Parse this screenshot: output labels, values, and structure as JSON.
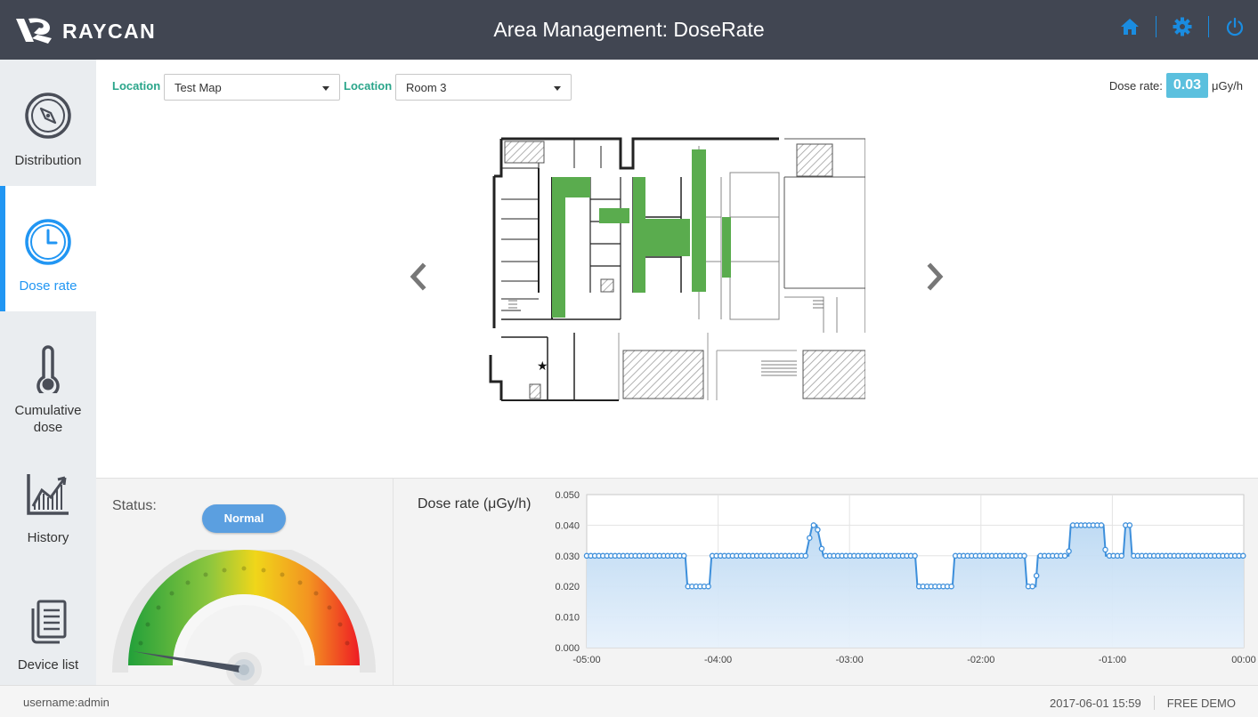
{
  "header": {
    "brand": "RAYCAN",
    "title": "Area Management: DoseRate",
    "icons": [
      "home-icon",
      "gear-icon",
      "power-icon"
    ],
    "icon_color": "#1a8ce0"
  },
  "sidebar": {
    "items": [
      {
        "label": "Distribution",
        "icon": "compass-icon"
      },
      {
        "label": "Dose rate",
        "icon": "clock-icon",
        "active": true
      },
      {
        "label": "Cumulative dose",
        "icon": "thermometer-icon"
      },
      {
        "label": "History",
        "icon": "chart-history-icon"
      },
      {
        "label": "Device list",
        "icon": "document-list-icon"
      }
    ],
    "active_color": "#2196f3"
  },
  "filters": {
    "location1_label": "Location",
    "location1_value": "Test Map",
    "location2_label": "Location",
    "location2_value": "Room 3"
  },
  "dose_rate": {
    "label": "Dose rate:",
    "value": "0.03",
    "unit": "μGy/h"
  },
  "map": {
    "marker": "★",
    "nav_prev": "chevron-left-icon",
    "nav_next": "chevron-right-icon"
  },
  "status": {
    "label": "Status:",
    "value": "Normal",
    "gauge_level": 0.02
  },
  "chart_data": {
    "type": "area",
    "title": "Dose rate (μGy/h)",
    "xlabel": "",
    "ylabel": "",
    "x_ticks": [
      "-05:00",
      "-04:00",
      "-03:00",
      "-02:00",
      "-01:00",
      "00:00"
    ],
    "y_ticks": [
      "0.000",
      "0.010",
      "0.020",
      "0.030",
      "0.040",
      "0.050"
    ],
    "ylim": [
      0,
      0.05
    ],
    "xlim_minutes": [
      -300,
      0
    ],
    "grid": true,
    "series": [
      {
        "x_minutes": [
          -300,
          -255,
          -254,
          -244,
          -243,
          -200,
          -197,
          -195,
          -192,
          -150,
          -149,
          -133,
          -132,
          -100,
          -99,
          -95,
          -94,
          -80,
          -79,
          -64,
          -63,
          -55,
          -54,
          -52,
          -51,
          0
        ],
        "values": [
          0.03,
          0.03,
          0.02,
          0.02,
          0.03,
          0.03,
          0.04,
          0.04,
          0.03,
          0.03,
          0.02,
          0.02,
          0.03,
          0.03,
          0.02,
          0.02,
          0.03,
          0.03,
          0.04,
          0.04,
          0.03,
          0.03,
          0.04,
          0.04,
          0.03,
          0.03
        ]
      }
    ],
    "colors": {
      "line": "#3d8fdb",
      "fill_top": "#bcd9f3",
      "fill_bottom": "#e7f1fb"
    }
  },
  "footer": {
    "user": "username:admin",
    "datetime": "2017-06-01 15:59",
    "edition": "FREE DEMO"
  }
}
